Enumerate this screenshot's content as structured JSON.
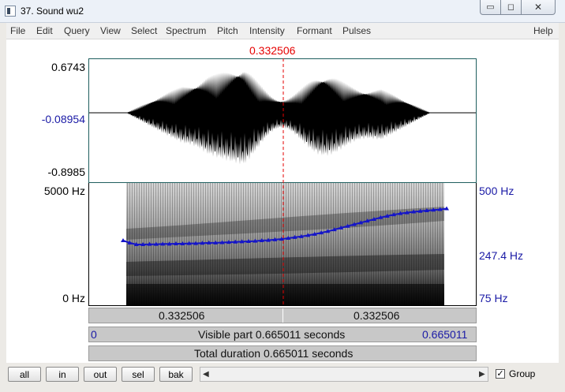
{
  "window": {
    "title": "37. Sound wu2",
    "minimize": "▭",
    "maximize": "◻",
    "close": "✕"
  },
  "menu": [
    "File",
    "Edit",
    "Query",
    "View",
    "Select",
    "Spectrum",
    "Pitch",
    "Intensity",
    "Formant",
    "Pulses"
  ],
  "menu_help": "Help",
  "cursor_time": "0.332506",
  "waveform": {
    "top": "0.6743",
    "middle": "-0.08954",
    "bottom": "-0.8985"
  },
  "spectrogram": {
    "top_left": "5000 Hz",
    "bottom_left": "0 Hz",
    "top_right": "500 Hz",
    "mid_right": "247.4 Hz",
    "bottom_right": "75 Hz"
  },
  "pitch_track": [
    300,
    292,
    286,
    286,
    287,
    287,
    288,
    288,
    289,
    289,
    290,
    290,
    291,
    292,
    292,
    293,
    294,
    295,
    296,
    297,
    298,
    300,
    301,
    303,
    305,
    308,
    311,
    314,
    318,
    322,
    327,
    332,
    338,
    344,
    350,
    356,
    362,
    368,
    374,
    380,
    385,
    390,
    394,
    397,
    400,
    402,
    404,
    406,
    408,
    411
  ],
  "bars": {
    "left_half": "0.332506",
    "right_half": "0.332506",
    "visible_start": "0",
    "visible_label": "Visible part 0.665011 seconds",
    "visible_end": "0.665011",
    "total_label": "Total duration 0.665011 seconds"
  },
  "toolbar": {
    "all": "all",
    "in": "in",
    "out": "out",
    "sel": "sel",
    "bak": "bak",
    "scroll_left": "◀",
    "scroll_right": "▶",
    "group_check": "✓",
    "group_label": "Group"
  },
  "colors": {
    "cursor": "#e60000",
    "pitch": "#1515c8",
    "axis_right": "#1a1aa6"
  }
}
